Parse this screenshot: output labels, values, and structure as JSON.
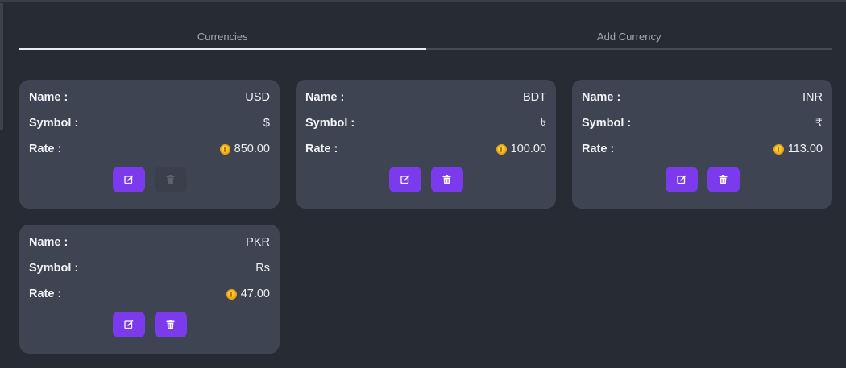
{
  "tabs": [
    {
      "label": "Currencies",
      "active": true
    },
    {
      "label": "Add Currency",
      "active": false
    }
  ],
  "labels": {
    "name": "Name :",
    "symbol": "Symbol :",
    "rate": "Rate :"
  },
  "cards": [
    {
      "name": "USD",
      "symbol": "$",
      "rate": "850.00",
      "delete_enabled": false
    },
    {
      "name": "BDT",
      "symbol": "৳",
      "rate": "100.00",
      "delete_enabled": true
    },
    {
      "name": "INR",
      "symbol": "₹",
      "rate": "113.00",
      "delete_enabled": true
    },
    {
      "name": "PKR",
      "symbol": "Rs",
      "rate": "47.00",
      "delete_enabled": true
    }
  ],
  "icons": {
    "rate": "coin-icon",
    "edit": "edit-icon",
    "delete": "trash-icon"
  },
  "colors": {
    "accent": "#7c3aed",
    "card": "#3e4452",
    "background": "#272b34"
  }
}
